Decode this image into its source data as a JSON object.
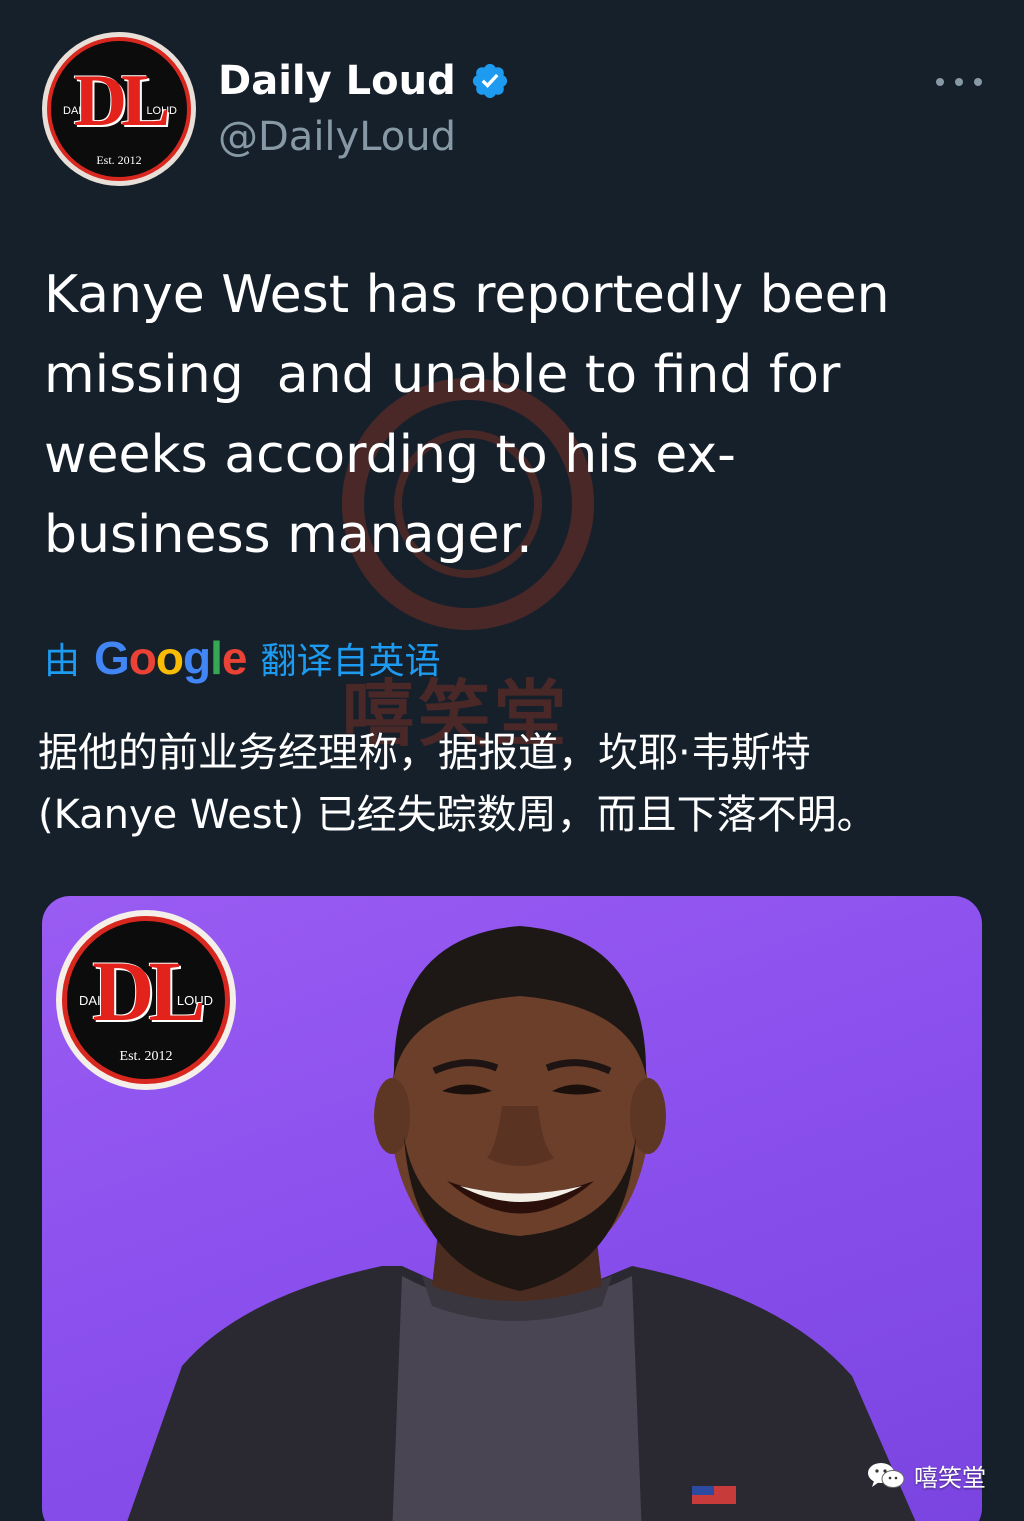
{
  "tweet": {
    "author": {
      "display_name": "Daily Loud",
      "handle": "@DailyLoud",
      "verified": true,
      "avatar_icon": "daily-loud-logo"
    },
    "more_icon": "more-horizontal-icon",
    "text": "Kanye West has reportedly been\nmissing  and unable to find for\nweeks according to his ex-\nbusiness manager.",
    "translation": {
      "prefix": "由",
      "provider": "Google",
      "suffix": "翻译自英语",
      "text": "据他的前业务经理称，据报道，坎耶·韦斯特\n(Kanye West) 已经失踪数周，而且下落不明。"
    }
  },
  "logo": {
    "letters": "DL",
    "left_word": "DAILY",
    "right_word": "LOUD",
    "est": "Est. 2012"
  },
  "watermark": {
    "text": "嘻笑堂"
  },
  "caption": {
    "icon": "wechat-icon",
    "text": "嘻笑堂"
  },
  "colors": {
    "background": "#15202b",
    "text": "#ffffff",
    "secondary_text": "#8899a6",
    "link": "#1d9bf0",
    "verified": "#1d9bf0",
    "media_bg": "#8b50ee",
    "logo_red": "#e3231b"
  }
}
